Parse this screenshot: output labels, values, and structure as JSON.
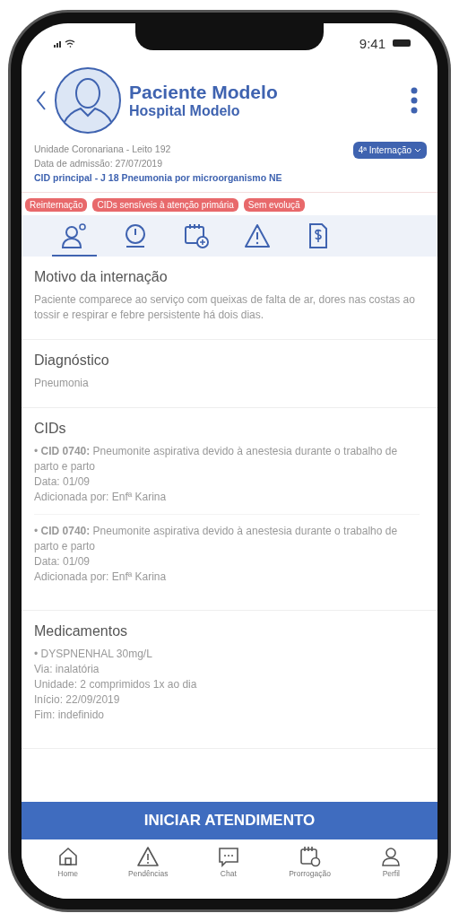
{
  "status_bar": {
    "time": "9:41"
  },
  "header": {
    "name": "Paciente Modelo",
    "hospital": "Hospital Modelo"
  },
  "info": {
    "unit": "Unidade Coronariana - Leito 192",
    "admission": "Data de admissão: 27/07/2019",
    "main_cid": "CID principal - J 18 Pneumonia por microorganismo NE",
    "stay_dropdown": "4ª Internação"
  },
  "tags": [
    "Reinternação",
    "CIDs sensíveis à atenção primária",
    "Sem evoluçã"
  ],
  "tabs": [
    {
      "kind": "patient",
      "selected": true
    },
    {
      "kind": "timer",
      "selected": false
    },
    {
      "kind": "calendar",
      "selected": false
    },
    {
      "kind": "alert",
      "selected": false
    },
    {
      "kind": "billing",
      "selected": false
    }
  ],
  "sections": [
    {
      "kind": "text",
      "title": "Motivo da internação",
      "text": "Paciente comparece ao serviço com queixas de falta de ar, dores nas costas ao tossir e respirar e febre persistente há dois dias."
    },
    {
      "kind": "text",
      "title": "Diagnóstico",
      "text": "Pneumonia"
    },
    {
      "kind": "entries",
      "title": "CIDs",
      "entries": [
        {
          "lines": [
            "• **CID 0740:** Pneumonite aspirativa devido à anestesia durante o trabalho de parto e parto",
            "Data: 01/09",
            "Adicionada por: Enfª Karina"
          ]
        },
        {
          "lines": [
            "• **CID 0740:** Pneumonite aspirativa devido à anestesia durante o trabalho de parto e parto",
            "Data: 01/09",
            "Adicionada por: Enfª Karina"
          ]
        }
      ]
    },
    {
      "kind": "entries",
      "title": "Medicamentos",
      "entries": [
        {
          "lines": [
            "• DYSPNENHAL 30mg/L",
            "Via: inalatória",
            "Unidade: 2 comprimidos 1x ao dia",
            "Início: 22/09/2019",
            "Fim: indefinido"
          ]
        }
      ]
    }
  ],
  "action_button": "INICIAR ATENDIMENTO",
  "bottom_nav": [
    {
      "kind": "home",
      "label": "Home"
    },
    {
      "kind": "alert",
      "label": "Pendências"
    },
    {
      "kind": "chat",
      "label": "Chat"
    },
    {
      "kind": "calendar",
      "label": "Prorrogação"
    },
    {
      "kind": "profile",
      "label": "Perfil"
    }
  ]
}
